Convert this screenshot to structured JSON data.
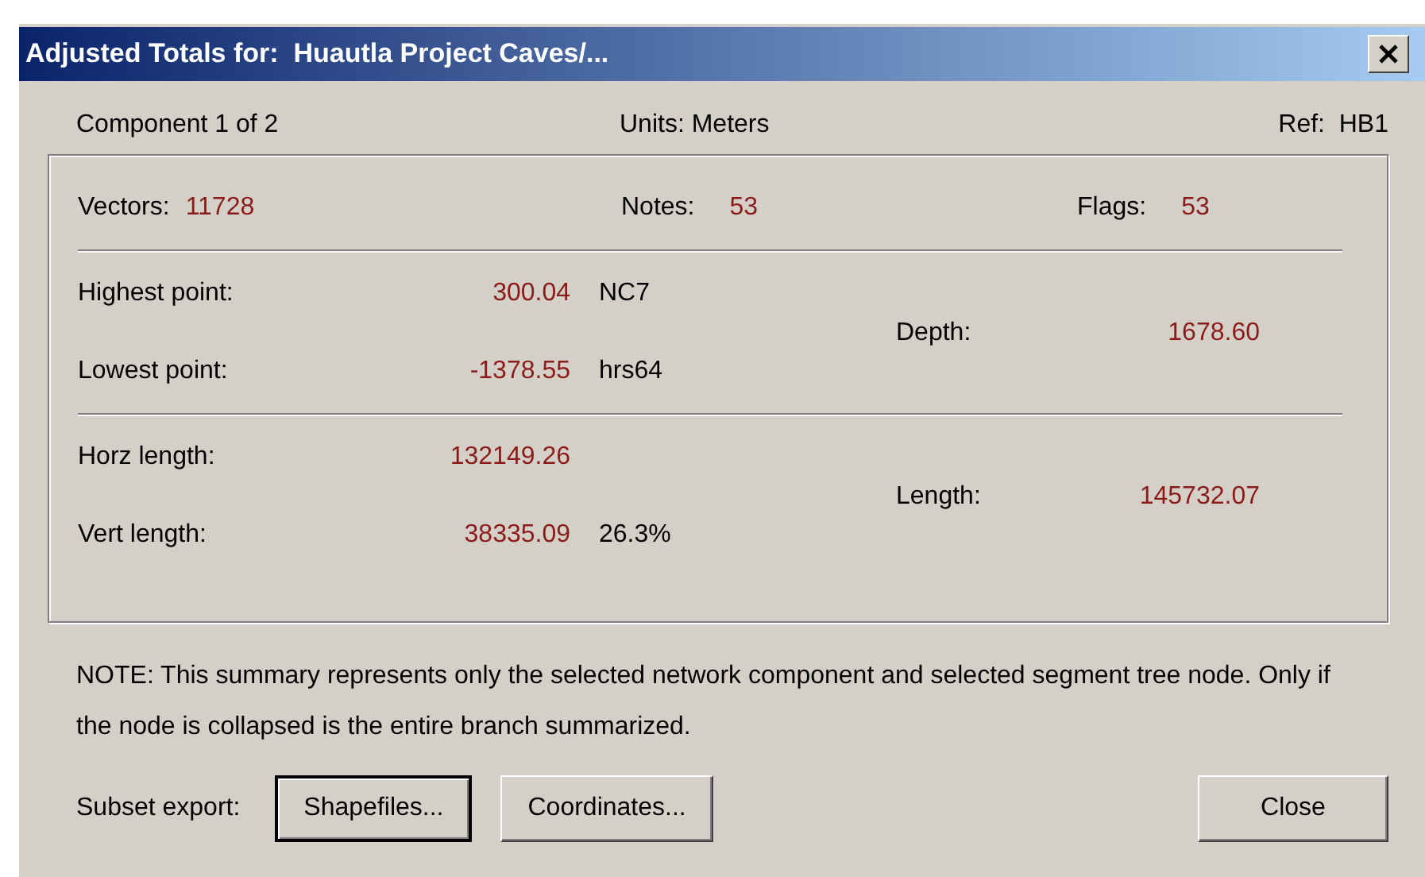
{
  "window": {
    "title": "Adjusted Totals for:  Huautla Project Caves/..."
  },
  "header": {
    "component": "Component 1 of 2",
    "units": "Units: Meters",
    "ref": "Ref:  HB1"
  },
  "counts": [
    {
      "label": "Vectors:",
      "value": "11728"
    },
    {
      "label": "Notes:",
      "value": "53"
    },
    {
      "label": "Flags:",
      "value": "53"
    }
  ],
  "elevation": {
    "rows": [
      {
        "label": "Highest point:",
        "value": "300.04",
        "extra": "NC7"
      },
      {
        "label": "Lowest point:",
        "value": "-1378.55",
        "extra": "hrs64"
      }
    ],
    "total": {
      "label": "Depth:",
      "value": "1678.60"
    }
  },
  "lengths": {
    "rows": [
      {
        "label": "Horz length:",
        "value": "132149.26"
      },
      {
        "label": "Vert length:",
        "value": "38335.09",
        "extra": "26.3%"
      }
    ],
    "total": {
      "label": "Length:",
      "value": "145732.07"
    }
  },
  "note": "NOTE: This summary represents only the selected network component and selected segment tree node. Only if the node is collapsed is the entire branch summarized.",
  "export_label": "Subset export:",
  "buttons": [
    {
      "label": "Shapefiles...",
      "default": true
    },
    {
      "label": "Coordinates...",
      "default": false
    },
    {
      "label": "Close",
      "default": false
    }
  ]
}
